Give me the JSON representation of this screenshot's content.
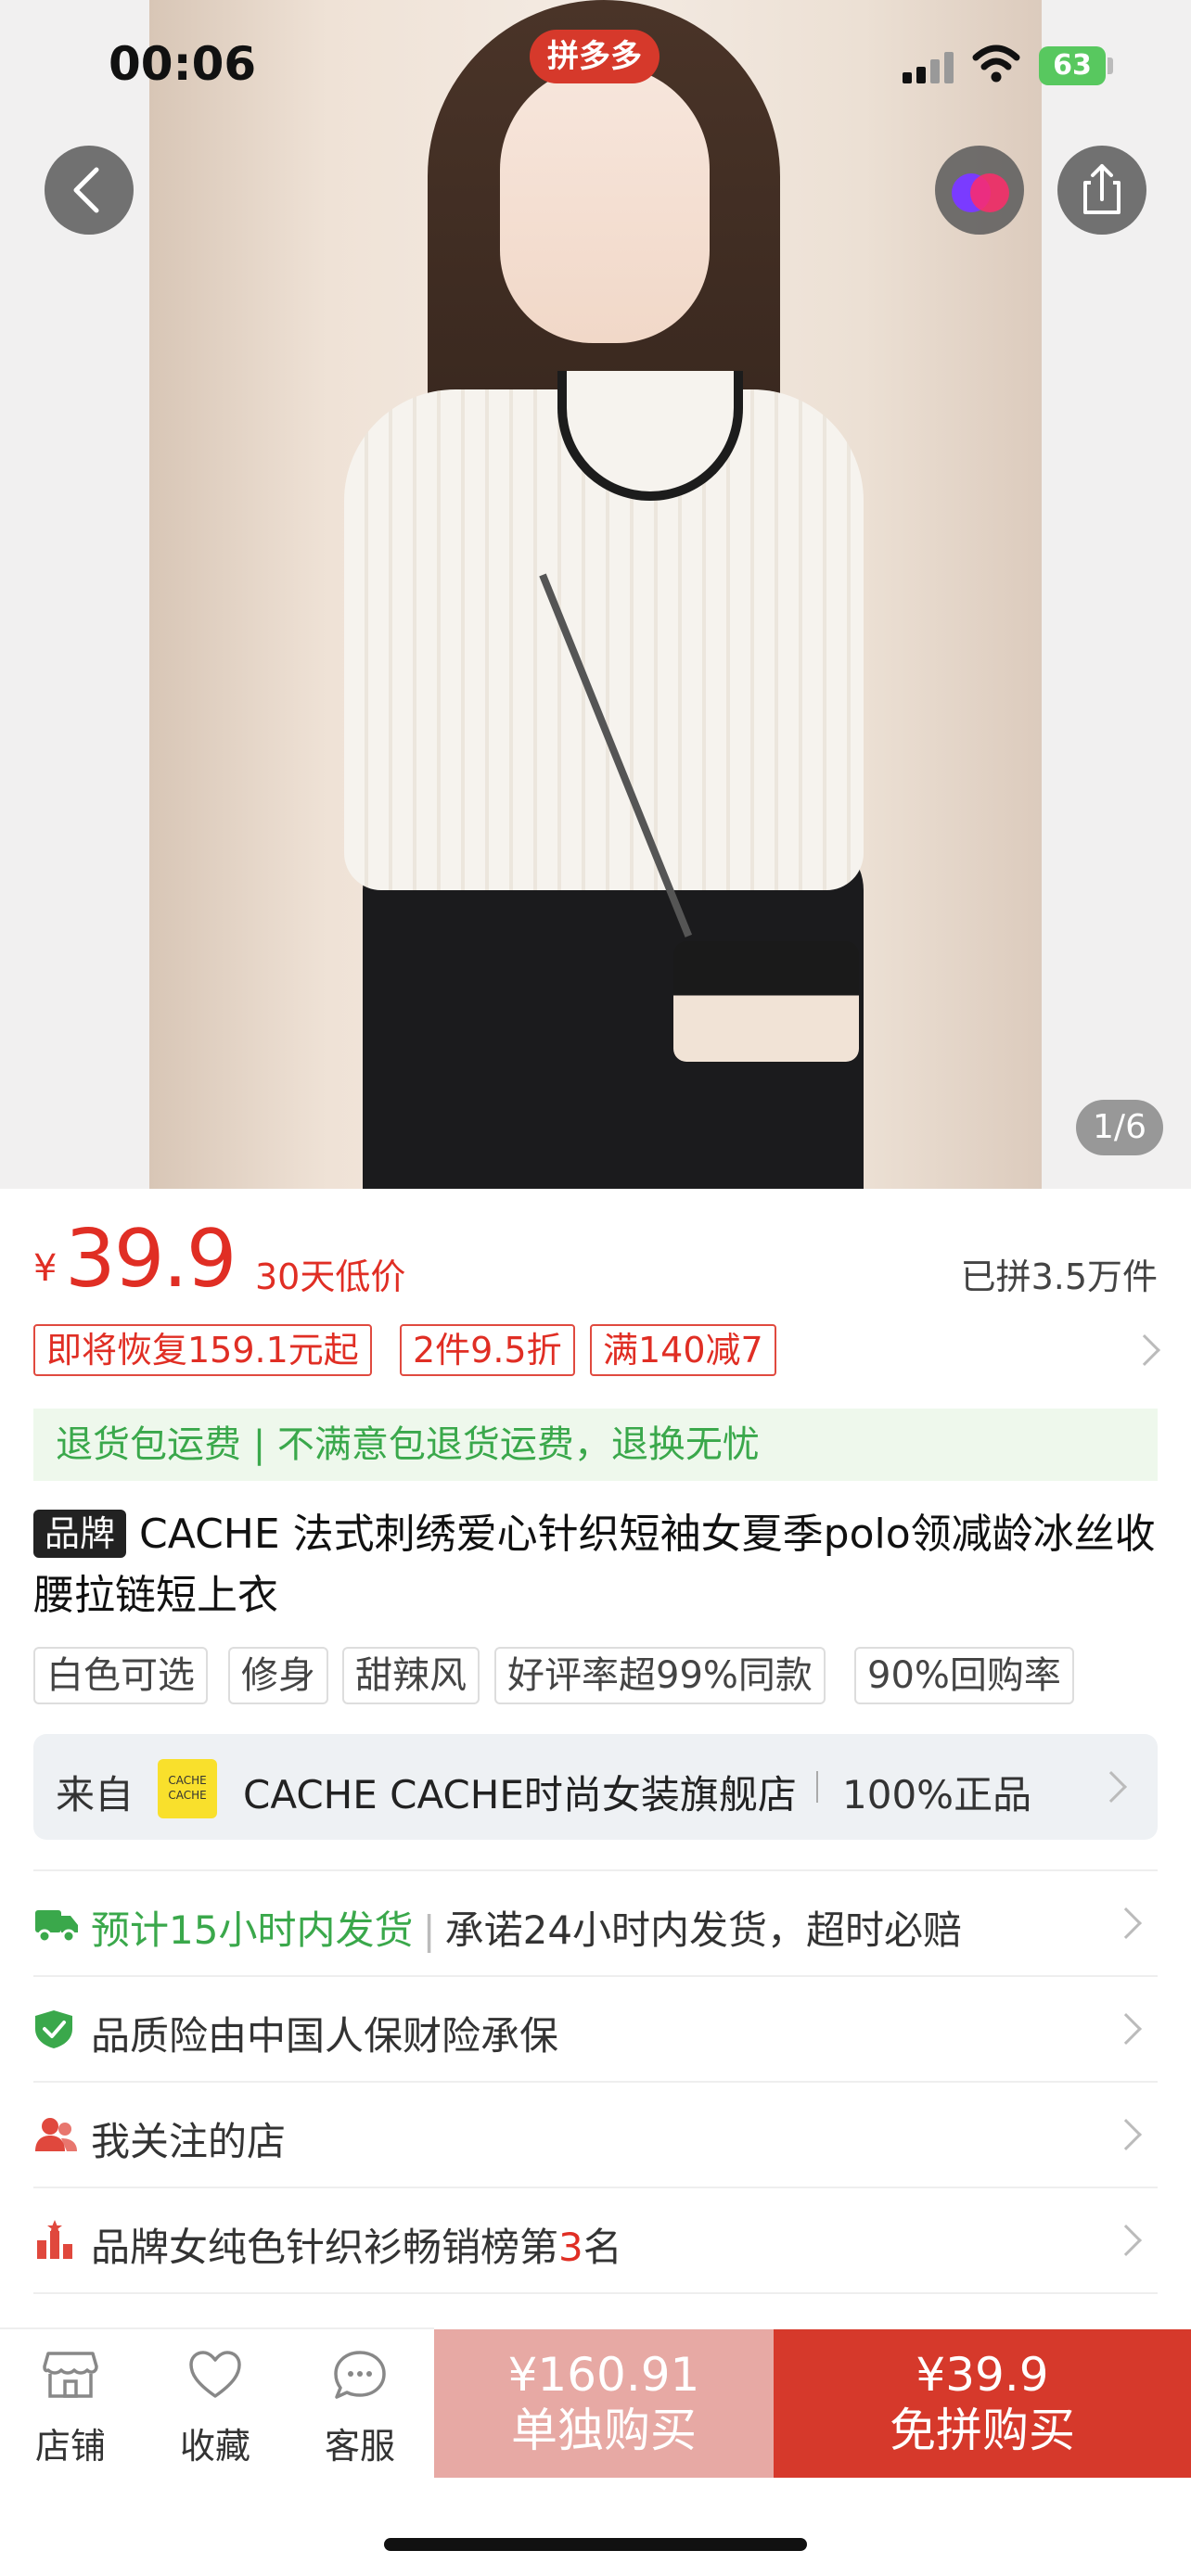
{
  "status_bar": {
    "time": "00:06",
    "app_badge": "拼多多",
    "battery": "63"
  },
  "gallery": {
    "counter": "1/6",
    "back_icon": "chevron-left-icon",
    "share_icon": "share-icon",
    "assistant_icon": "assistant-icon"
  },
  "price": {
    "currency": "¥",
    "value": "39.9",
    "low_tag": "30天低价",
    "sold": "已拼3.5万件"
  },
  "promo_tags": [
    "即将恢复159.1元起",
    "2件9.5折",
    "满140减7"
  ],
  "return_banner": "退货包运费 | 不满意包退货运费，退换无忧",
  "product": {
    "brand_tag": "品牌",
    "title": "CACHE 法式刺绣爱心针织短袖女夏季polo领减龄冰丝收腰拉链短上衣",
    "attributes": [
      "白色可选",
      "修身",
      "甜辣风",
      "好评率超99%同款",
      "90%回购率"
    ]
  },
  "shop": {
    "from_label": "来自",
    "logo_text": "CACHE CACHE",
    "name": "CACHE CACHE时尚女装旗舰店",
    "genuine": "100%正品"
  },
  "service_rows": [
    {
      "icon": "truck-icon",
      "highlight": "预计15小时内发货",
      "text": "承诺24小时内发货，超时必赔"
    },
    {
      "icon": "shield-check-icon",
      "text": "品质险由中国人保财险承保"
    },
    {
      "icon": "people-icon",
      "text": "我关注的店"
    },
    {
      "icon": "ranking-icon",
      "text_before": "品牌女纯色针织衫畅销榜第",
      "rank": "3",
      "text_after": "名"
    }
  ],
  "bottom_bar": {
    "store": "店铺",
    "favorite": "收藏",
    "service": "客服",
    "single_price": "¥160.91",
    "single_label": "单独购买",
    "group_price": "¥39.9",
    "group_label": "免拼购买"
  },
  "colors": {
    "accent": "#e02e24",
    "green": "#3aa84b",
    "single_btn": "#e7a9a4",
    "group_btn": "#d6392b"
  }
}
